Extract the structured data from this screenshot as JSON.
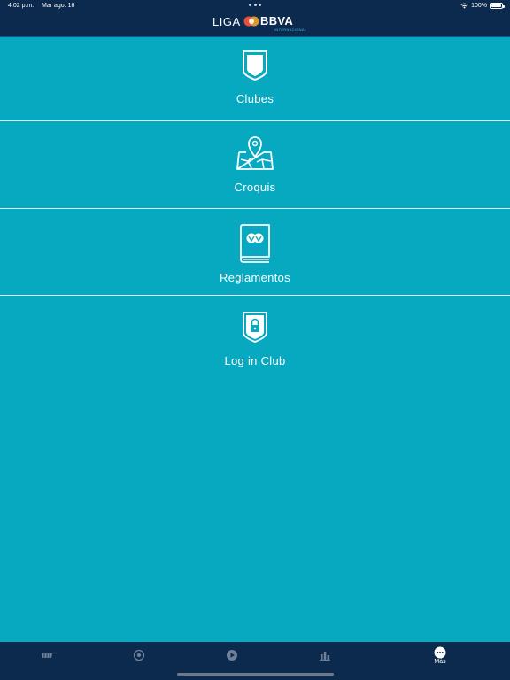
{
  "status_bar": {
    "time": "4:02 p.m.",
    "date": "Mar ago. 16",
    "battery": "100%"
  },
  "logo": {
    "liga": "LIGA",
    "bbva": "BBVA",
    "subtitle": "INTERNACIONAL"
  },
  "menu": {
    "items": [
      {
        "label": "Clubes",
        "icon": "shield-icon"
      },
      {
        "label": "Croquis",
        "icon": "map-pin-icon"
      },
      {
        "label": "Reglamentos",
        "icon": "book-icon"
      },
      {
        "label": "Log in Club",
        "icon": "shield-lock-icon"
      }
    ]
  },
  "tabbar": {
    "tabs": [
      {
        "label": "",
        "icon": "stadium-icon"
      },
      {
        "label": "",
        "icon": "soccer-ball-icon"
      },
      {
        "label": "",
        "icon": "play-icon"
      },
      {
        "label": "",
        "icon": "bar-chart-icon"
      },
      {
        "label": "Más",
        "icon": "more-icon"
      }
    ]
  },
  "colors": {
    "background": "#06a9c0",
    "header": "#0c2a4d",
    "accent": "#3fb4e6"
  }
}
